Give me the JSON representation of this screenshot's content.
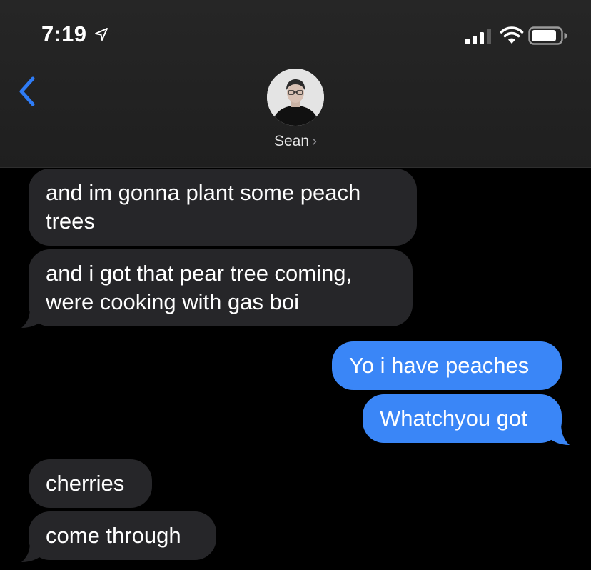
{
  "status_bar": {
    "time": "7:19",
    "icons": [
      "location-arrow-icon",
      "cellular-signal-icon",
      "wifi-icon",
      "battery-icon"
    ]
  },
  "nav": {
    "back_icon": "chevron-left-icon",
    "contact_name": "Sean",
    "contact_chevron": "›",
    "avatar_icon": "contact-avatar"
  },
  "colors": {
    "background": "#000000",
    "header": "#232323",
    "incoming_bubble": "#262629",
    "outgoing_bubble": "#3a86f7",
    "accent": "#2f7cf6"
  },
  "messages": [
    {
      "direction": "incoming",
      "lines": [
        "and im gonna plant some peach",
        "trees"
      ]
    },
    {
      "direction": "incoming",
      "lines": [
        "and i got that pear tree coming,",
        "were cooking with gas boi"
      ]
    },
    {
      "direction": "outgoing",
      "lines": [
        "Yo i have peaches"
      ]
    },
    {
      "direction": "outgoing",
      "lines": [
        "Whatchyou got"
      ]
    },
    {
      "direction": "incoming",
      "lines": [
        "cherries"
      ]
    },
    {
      "direction": "incoming",
      "lines": [
        "come through"
      ]
    }
  ]
}
